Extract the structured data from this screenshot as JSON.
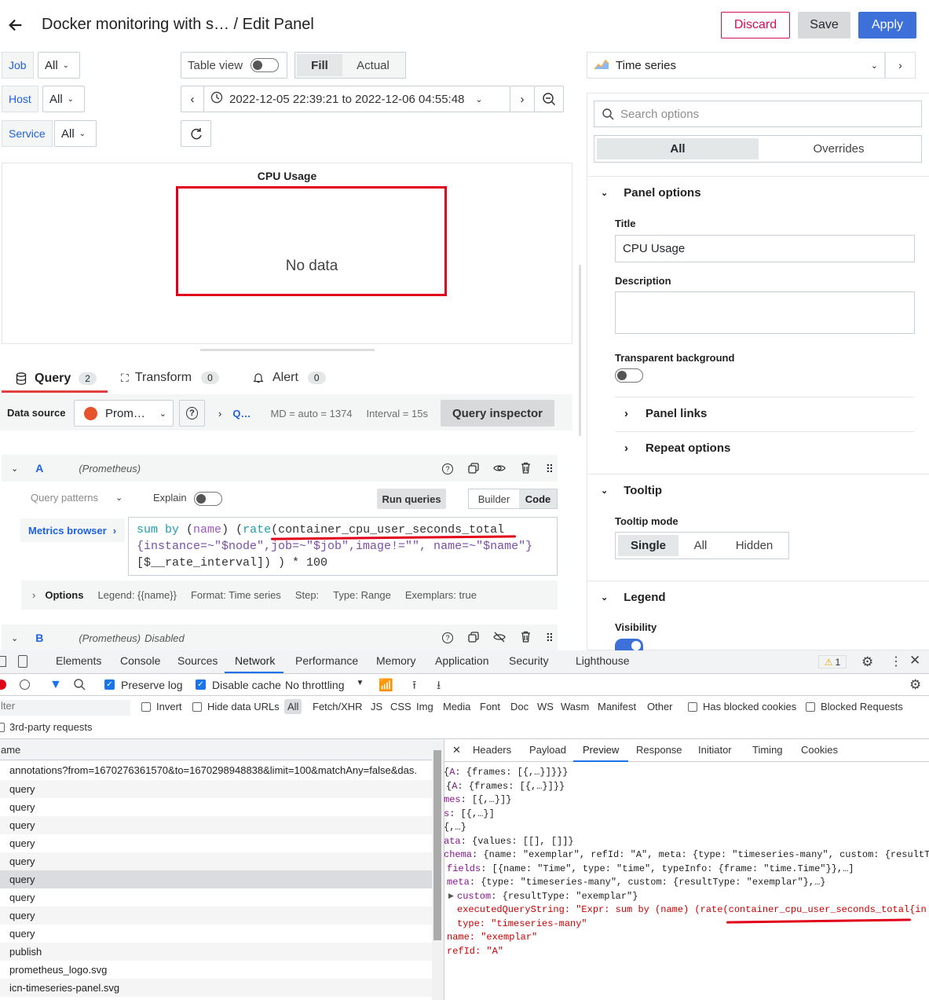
{
  "header": {
    "breadcrumb_dashboard": "Docker monitoring with s…",
    "breadcrumb_sep": "/",
    "breadcrumb_page": "Edit Panel",
    "discard_label": "Discard",
    "save_label": "Save",
    "apply_label": "Apply"
  },
  "variables": [
    {
      "label": "Job",
      "value": "All"
    },
    {
      "label": "Host",
      "value": "All"
    },
    {
      "label": "Service",
      "value": "All"
    }
  ],
  "toolbar": {
    "table_view_label": "Table view",
    "fill_label": "Fill",
    "actual_label": "Actual",
    "time_range": "2022-12-05 22:39:21 to 2022-12-06 04:55:48"
  },
  "panel": {
    "title": "CPU Usage",
    "no_data": "No data"
  },
  "query_tabs": {
    "query_label": "Query",
    "query_count": "2",
    "transform_label": "Transform",
    "transform_count": "0",
    "alert_label": "Alert",
    "alert_count": "0"
  },
  "datasource_row": {
    "label": "Data source",
    "datasource": "Prom…",
    "query_options_short": "Q…",
    "md": "MD = auto = 1374",
    "interval": "Interval = 15s",
    "inspector_label": "Query inspector"
  },
  "query_a": {
    "ref": "A",
    "source": "(Prometheus)",
    "patterns_label": "Query patterns",
    "explain_label": "Explain",
    "run_label": "Run queries",
    "builder_label": "Builder",
    "code_label": "Code",
    "metrics_browser_label": "Metrics browser",
    "expr_line1_a": "sum by",
    "expr_line1_b": "(",
    "expr_line1_c": "name",
    "expr_line1_d": ") (",
    "expr_line1_e": "rate",
    "expr_line1_f": "(container_cpu_user_seconds_total",
    "expr_line2": "{instance=~\"$node\",job=~\"$job\",image!=\"\", name=~\"$name\"}",
    "expr_line3": "[$__rate_interval]) ) * 100",
    "options_label": "Options",
    "legend": "Legend: {{name}}",
    "format": "Format: Time series",
    "step": "Step:",
    "type": "Type: Range",
    "exemplars": "Exemplars: true"
  },
  "query_b": {
    "ref": "B",
    "source": "(Prometheus)",
    "status": "Disabled"
  },
  "options_pane": {
    "viz_label": "Time series",
    "search_placeholder": "Search options",
    "all_tab": "All",
    "overrides_tab": "Overrides",
    "panel_options_header": "Panel options",
    "title_label": "Title",
    "title_value": "CPU Usage",
    "description_label": "Description",
    "transparent_label": "Transparent background",
    "panel_links": "Panel links",
    "repeat_options": "Repeat options",
    "tooltip_header": "Tooltip",
    "tooltip_mode_label": "Tooltip mode",
    "tooltip_modes": [
      "Single",
      "All",
      "Hidden"
    ],
    "legend_header": "Legend",
    "visibility_label": "Visibility"
  },
  "devtools": {
    "tabs": [
      "Elements",
      "Console",
      "Sources",
      "Network",
      "Performance",
      "Memory",
      "Application",
      "Security",
      "Lighthouse"
    ],
    "active_tab": "Network",
    "warning_count": "1",
    "preserve_log": "Preserve log",
    "disable_cache": "Disable cache",
    "throttling": "No throttling",
    "filter_placeholder": "lter",
    "invert": "Invert",
    "hide_data_urls": "Hide data URLs",
    "types": [
      "All",
      "Fetch/XHR",
      "JS",
      "CSS",
      "Img",
      "Media",
      "Font",
      "Doc",
      "WS",
      "Wasm",
      "Manifest",
      "Other"
    ],
    "has_blocked_cookies": "Has blocked cookies",
    "blocked_requests": "Blocked Requests",
    "third_party": "3rd-party requests",
    "name_header": "ame",
    "requests": [
      "annotations?from=1670276361570&to=1670298948838&limit=100&matchAny=false&das.",
      "query",
      "query",
      "query",
      "query",
      "query",
      "query",
      "query",
      "query",
      "query",
      "publish",
      "prometheus_logo.svg",
      "icn-timeseries-panel.svg"
    ],
    "detail_tabs": [
      "Headers",
      "Payload",
      "Preview",
      "Response",
      "Initiator",
      "Timing",
      "Cookies"
    ],
    "detail_active": "Preview",
    "preview_lines": [
      "{A: {frames: [{,…}]}}}",
      "{A: {frames: [{,…}]}}",
      "mes: [{,…}]}",
      "s: [{,…}]",
      "{,…}",
      "ata: {values: [[], []]}",
      "chema: {name: \"exemplar\", refId: \"A\", meta: {type: \"timeseries-many\", custom: {resultT",
      "fields: [{name: \"Time\", type: \"time\", typeInfo: {frame: \"time.Time\"}},…]",
      "meta: {type: \"timeseries-many\", custom: {resultType: \"exemplar\"},…}",
      "custom: {resultType: \"exemplar\"}",
      "executedQueryString: \"Expr: sum by (name) (rate(container_cpu_user_seconds_total{in",
      "type: \"timeseries-many\"",
      "name: \"exemplar\"",
      "refId: \"A\""
    ]
  },
  "colors": {
    "accent": "#3d71d9",
    "discard": "#d10e5c",
    "annotation_red": "#e0001a",
    "devtools_blue": "#1a73e8"
  }
}
